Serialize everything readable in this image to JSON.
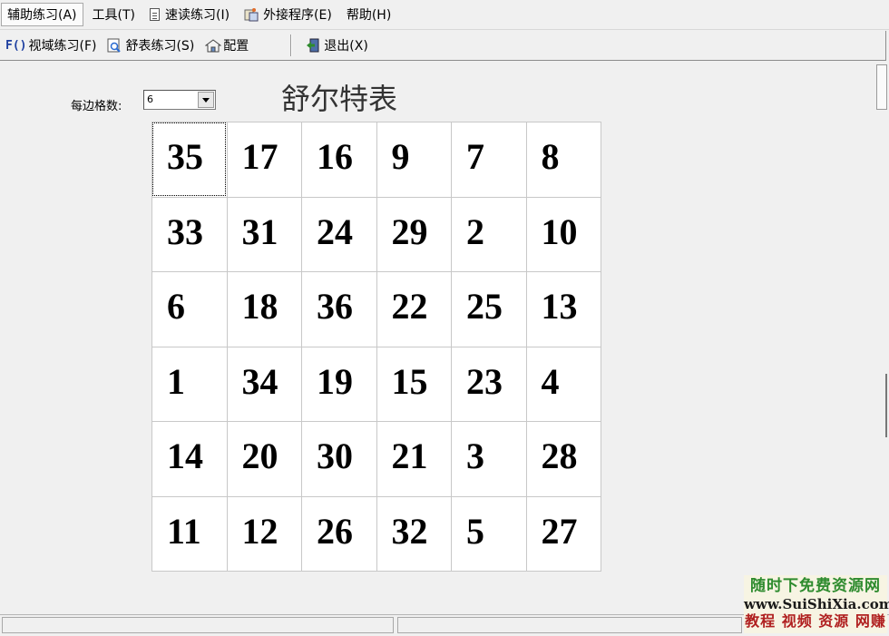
{
  "menu": [
    {
      "label": "辅助练习(A)",
      "icon": ""
    },
    {
      "label": "工具(T)",
      "icon": ""
    },
    {
      "label": "速读练习(I)",
      "icon": "document-icon"
    },
    {
      "label": "外接程序(E)",
      "icon": "puzzle-icon"
    },
    {
      "label": "帮助(H)",
      "icon": ""
    }
  ],
  "toolbar": {
    "field_practice": {
      "icon_text": "F()",
      "label": "视域练习(F)"
    },
    "schulte_practice": {
      "label": "舒表练习(S)",
      "icon": "magnifier-doc-icon"
    },
    "config": {
      "label": "配置",
      "icon": "config-icon"
    },
    "exit": {
      "label": "退出(X)",
      "icon": "exit-door-icon"
    }
  },
  "settings": {
    "cells_per_side_label": "每边格数:",
    "cells_per_side_value": "6"
  },
  "title": "舒尔特表",
  "grid": [
    [
      "35",
      "17",
      "16",
      "9",
      "7",
      "8"
    ],
    [
      "33",
      "31",
      "24",
      "29",
      "2",
      "10"
    ],
    [
      "6",
      "18",
      "36",
      "22",
      "25",
      "13"
    ],
    [
      "1",
      "34",
      "19",
      "15",
      "23",
      "4"
    ],
    [
      "14",
      "20",
      "30",
      "21",
      "3",
      "28"
    ],
    [
      "11",
      "12",
      "26",
      "32",
      "5",
      "27"
    ]
  ],
  "watermark": {
    "line1": "随时下免费资源网",
    "line2": "www.SuiShiXia.com",
    "line3": "教程 视频 资源 网赚"
  }
}
